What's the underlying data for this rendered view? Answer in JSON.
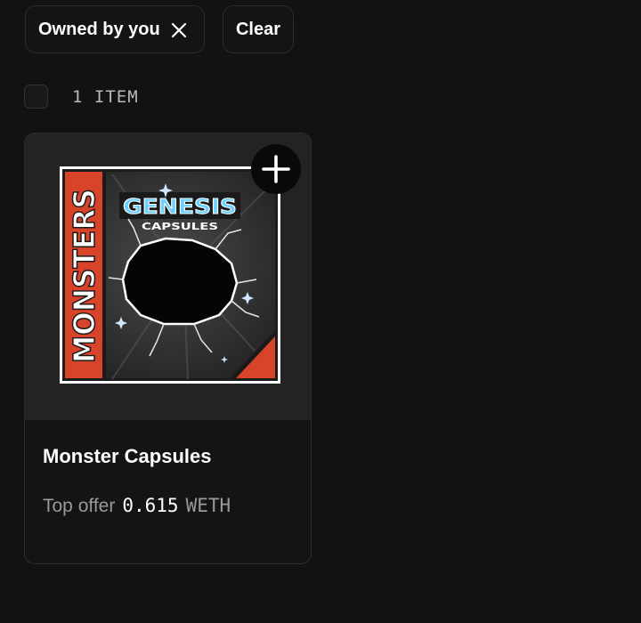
{
  "filters": {
    "owned_label": "Owned by you",
    "clear_label": "Clear"
  },
  "results": {
    "count_label": "1 ITEM"
  },
  "card": {
    "title": "Monster Capsules",
    "offer_label": "Top offer",
    "offer_value": "0.615",
    "offer_currency": "WETH",
    "art": {
      "side_text": "MONSTERS",
      "logo_top": "GENESIS",
      "logo_bottom": "CAPSULES"
    }
  },
  "colors": {
    "background": "#121212",
    "card": "#141414",
    "media": "#232323",
    "accent_orange": "#d8442a"
  }
}
